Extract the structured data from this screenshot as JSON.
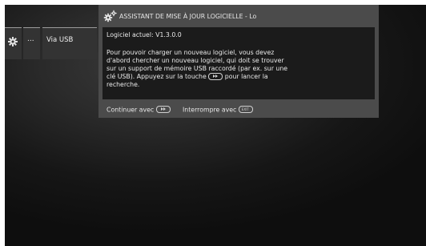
{
  "menu": {
    "settings_icon": "gear-icon",
    "more_label": "...",
    "usb_label": "Via USB"
  },
  "dialog": {
    "icon": "gears-icon",
    "title": "ASSISTANT DE MISE À JOUR LOGICIELLE - Lo",
    "current_software": "Logiciel actuel: V1.3.0.0",
    "info_lines": [
      "Pour pouvoir charger un nouveau logiciel, vous devez",
      "d'abord chercher un nouveau logiciel, qui doit se trouver",
      "sur un support de mémoire USB raccordé (par ex. sur une"
    ],
    "info_line4_before": "clé USB). Appuyez sur la touche",
    "info_line4_after": "pour lancer la",
    "info_line5": "recherche.",
    "continue_label": "Continuer avec",
    "abort_label": "Interrompre avec",
    "play_key_icon": "play-key-icon",
    "exit_key_icon": "exit-key-icon",
    "exit_key_text": "EXIT"
  }
}
